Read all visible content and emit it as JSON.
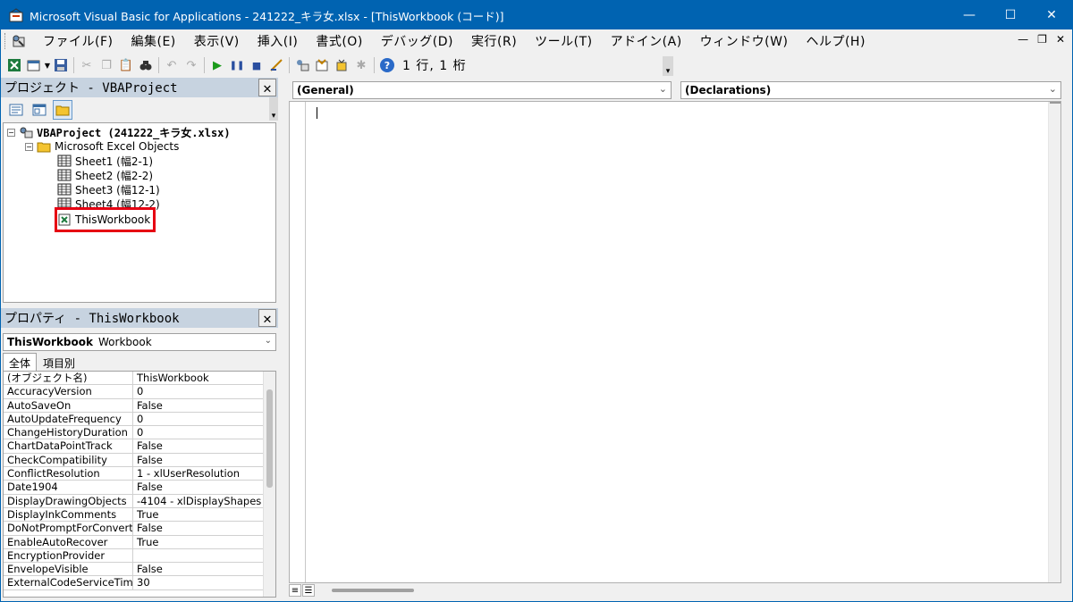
{
  "window": {
    "title": "Microsoft Visual Basic for Applications - 241222_キラ女.xlsx - [ThisWorkbook (コード)]",
    "minimize": "—",
    "maximize": "☐",
    "close": "✕"
  },
  "menu": {
    "items": [
      {
        "label": "ファイル(F)"
      },
      {
        "label": "編集(E)"
      },
      {
        "label": "表示(V)"
      },
      {
        "label": "挿入(I)"
      },
      {
        "label": "書式(O)"
      },
      {
        "label": "デバッグ(D)"
      },
      {
        "label": "実行(R)"
      },
      {
        "label": "ツール(T)"
      },
      {
        "label": "アドイン(A)"
      },
      {
        "label": "ウィンドウ(W)"
      },
      {
        "label": "ヘルプ(H)"
      }
    ],
    "doc_minimize": "—",
    "doc_restore": "❐",
    "doc_close": "✕"
  },
  "toolbar": {
    "cursor_position": "1 行, 1 桁"
  },
  "project_pane": {
    "title": "プロジェクト - VBAProject",
    "close": "✕",
    "root": "VBAProject (241222_キラ女.xlsx)",
    "folder": "Microsoft Excel Objects",
    "items": [
      {
        "label": "Sheet1 (幅2-1)"
      },
      {
        "label": "Sheet2 (幅2-2)"
      },
      {
        "label": "Sheet3 (幅12-1)"
      },
      {
        "label": "Sheet4 (幅12-2)"
      },
      {
        "label": "ThisWorkbook"
      }
    ]
  },
  "properties_pane": {
    "title": "プロパティ - ThisWorkbook",
    "close": "✕",
    "object_name": "ThisWorkbook",
    "object_type": "Workbook",
    "tabs": [
      {
        "label": "全体"
      },
      {
        "label": "項目別"
      }
    ],
    "rows": [
      {
        "name": "(オブジェクト名)",
        "value": "ThisWorkbook"
      },
      {
        "name": "AccuracyVersion",
        "value": "0"
      },
      {
        "name": "AutoSaveOn",
        "value": "False"
      },
      {
        "name": "AutoUpdateFrequency",
        "value": "0"
      },
      {
        "name": "ChangeHistoryDuration",
        "value": "0"
      },
      {
        "name": "ChartDataPointTrack",
        "value": "False"
      },
      {
        "name": "CheckCompatibility",
        "value": "False"
      },
      {
        "name": "ConflictResolution",
        "value": "1 - xlUserResolution"
      },
      {
        "name": "Date1904",
        "value": "False"
      },
      {
        "name": "DisplayDrawingObjects",
        "value": "-4104 - xlDisplayShapes"
      },
      {
        "name": "DisplayInkComments",
        "value": "True"
      },
      {
        "name": "DoNotPromptForConvert",
        "value": "False"
      },
      {
        "name": "EnableAutoRecover",
        "value": "True"
      },
      {
        "name": "EncryptionProvider",
        "value": ""
      },
      {
        "name": "EnvelopeVisible",
        "value": "False"
      },
      {
        "name": "ExternalCodeServiceTimeout",
        "value": "30"
      }
    ]
  },
  "code_window": {
    "object_combo": "(General)",
    "procedure_combo": "(Declarations)"
  },
  "colors": {
    "titlebar": "#0063b1",
    "highlight": "#e60012",
    "pane_header": "#c7d3e0"
  }
}
